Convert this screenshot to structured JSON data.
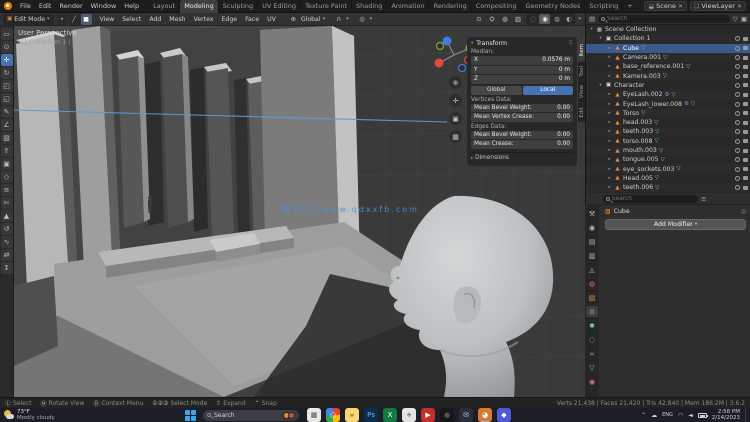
{
  "colors": {
    "accent": "#4772b3",
    "selection": "#3a5a8c",
    "header_bg": "#1d1d1d",
    "viewport_bg": "#464646",
    "mesh_icon": "#e58a3a",
    "data_icon": "#6fcf8f",
    "watermark_blue": "#4b8fe0",
    "blender_orange": "#e87d0d"
  },
  "topbar": {
    "menus": [
      {
        "label": "File"
      },
      {
        "label": "Edit"
      },
      {
        "label": "Render"
      },
      {
        "label": "Window"
      },
      {
        "label": "Help"
      }
    ],
    "workspaces": [
      {
        "label": "Layout"
      },
      {
        "label": "Modeling",
        "active": true
      },
      {
        "label": "Sculpting"
      },
      {
        "label": "UV Editing"
      },
      {
        "label": "Texture Paint"
      },
      {
        "label": "Shading"
      },
      {
        "label": "Animation"
      },
      {
        "label": "Rendering"
      },
      {
        "label": "Compositing"
      },
      {
        "label": "Geometry Nodes"
      },
      {
        "label": "Scripting"
      }
    ],
    "add_workspace": "+",
    "scene": {
      "icon": "⬓",
      "label": "Scene",
      "close": "✕"
    },
    "view_layer": {
      "icon": "❏",
      "label": "ViewLayer",
      "close": "✕"
    }
  },
  "viewport_header": {
    "mode_icon": "▣",
    "mode": "Edit Mode",
    "caret": "▾",
    "select_modes": [
      {
        "glyph": "•"
      },
      {
        "glyph": "╱"
      },
      {
        "glyph": "■",
        "active": true
      }
    ],
    "menus": [
      {
        "label": "View"
      },
      {
        "label": "Select"
      },
      {
        "label": "Add"
      },
      {
        "label": "Mesh"
      },
      {
        "label": "Vertex"
      },
      {
        "label": "Edge"
      },
      {
        "label": "Face"
      },
      {
        "label": "UV"
      }
    ],
    "orientation_icon": "⊕",
    "orientation": "Global",
    "snap_icon": "∩",
    "proportional_icon": "◎",
    "right_icons": [
      {
        "glyph": "⊙"
      },
      {
        "glyph": "⛭",
        "active": true
      },
      {
        "glyph": "◍"
      },
      {
        "glyph": "▥"
      }
    ],
    "shading_modes": [
      {
        "glyph": "◌"
      },
      {
        "glyph": "◉",
        "active": true
      },
      {
        "glyph": "◍"
      },
      {
        "glyph": "◐"
      }
    ]
  },
  "tools": [
    {
      "glyph": "▭"
    },
    {
      "glyph": "⊙"
    },
    {
      "glyph": "✛",
      "active": true
    },
    {
      "glyph": "↻"
    },
    {
      "glyph": "◰"
    },
    {
      "glyph": "◱"
    },
    {
      "glyph": "✎"
    },
    {
      "glyph": "∠"
    },
    {
      "glyph": "▧"
    },
    {
      "glyph": "⇑"
    },
    {
      "glyph": "▣"
    },
    {
      "glyph": "◇"
    },
    {
      "glyph": "≡"
    },
    {
      "glyph": "✄"
    },
    {
      "glyph": "▲"
    },
    {
      "glyph": "↺"
    },
    {
      "glyph": "∿"
    },
    {
      "glyph": "⇄"
    },
    {
      "glyph": "↕"
    }
  ],
  "viewport": {
    "overlay_line1": "User Perspective",
    "overlay_line2": "(1) Collection 1 | Cube",
    "watermark": "格艺CG  www.qdxxfb.com",
    "gizmo_buttons": [
      {
        "glyph": "⊕"
      },
      {
        "glyph": "✛"
      },
      {
        "glyph": "▣"
      },
      {
        "glyph": "▦"
      }
    ]
  },
  "npanel": {
    "title": "Transform",
    "dots": "⠿",
    "median_label": "Median:",
    "axes": [
      {
        "label": "X",
        "value": "0.0576 m"
      },
      {
        "label": "Y",
        "value": "0 m"
      },
      {
        "label": "Z",
        "value": "0 m"
      }
    ],
    "space_toggle": [
      {
        "label": "Global"
      },
      {
        "label": "Local",
        "active": true
      }
    ],
    "vertex_section": "Vertices Data:",
    "vertex_rows": [
      {
        "label": "Mean Bevel Weight:",
        "value": "0.00"
      },
      {
        "label": "Mean Vertex Crease:",
        "value": "0.00"
      }
    ],
    "edge_section": "Edges Data:",
    "edge_rows": [
      {
        "label": "Mean Bevel Weight:",
        "value": "0.00"
      },
      {
        "label": "Mean Crease:",
        "value": "0.00"
      }
    ],
    "dimensions_label": "Dimensions",
    "dimensions_arrow": "▸",
    "tabs": [
      {
        "label": "Item",
        "active": true
      },
      {
        "label": "Tool"
      },
      {
        "label": "View"
      },
      {
        "label": "Edit"
      }
    ]
  },
  "outliner": {
    "search_placeholder": "Search",
    "filter_icon": "▽",
    "display_icon": "▤",
    "new_collection_icon": "▣",
    "rows": [
      {
        "icon": "▦",
        "arrow": "▾",
        "name": "Scene Collection",
        "indent": 0,
        "cls": "ic-scene no-toggles"
      },
      {
        "icon": "▣",
        "arrow": "▾",
        "name": "Collection 1",
        "indent": 1,
        "cls": "ic-col"
      },
      {
        "icon": "▲",
        "arrow": "▸",
        "name": "Cube",
        "indent": 2,
        "cls": "ic-mesh has-data",
        "selected": true
      },
      {
        "icon": "▲",
        "arrow": "▸",
        "name": "Camera.001",
        "indent": 2,
        "cls": "ic-mesh has-data"
      },
      {
        "icon": "▲",
        "arrow": "▸",
        "name": "base_reference.001",
        "indent": 2,
        "cls": "ic-mesh has-data"
      },
      {
        "icon": "▲",
        "arrow": "▸",
        "name": "Kamera.003",
        "indent": 2,
        "cls": "ic-mesh has-data"
      },
      {
        "icon": "▣",
        "arrow": "▾",
        "name": "Character",
        "indent": 1,
        "cls": "ic-col"
      },
      {
        "icon": "▲",
        "arrow": "▸",
        "name": "EyeLash.002",
        "indent": 2,
        "cls": "ic-mesh has-wrench has-data"
      },
      {
        "icon": "▲",
        "arrow": "▸",
        "name": "EyeLash_lower.008",
        "indent": 2,
        "cls": "ic-mesh has-wrench has-data"
      },
      {
        "icon": "▲",
        "arrow": "▸",
        "name": "Torso",
        "indent": 2,
        "cls": "ic-mesh has-data"
      },
      {
        "icon": "▲",
        "arrow": "▸",
        "name": "head.003",
        "indent": 2,
        "cls": "ic-mesh has-data"
      },
      {
        "icon": "▲",
        "arrow": "▸",
        "name": "teeth.003",
        "indent": 2,
        "cls": "ic-mesh has-data"
      },
      {
        "icon": "▲",
        "arrow": "▸",
        "name": "torso.008",
        "indent": 2,
        "cls": "ic-mesh has-data"
      },
      {
        "icon": "▲",
        "arrow": "▸",
        "name": "mouth.003",
        "indent": 2,
        "cls": "ic-mesh has-data"
      },
      {
        "icon": "▲",
        "arrow": "▸",
        "name": "tongue.005",
        "indent": 2,
        "cls": "ic-mesh has-data"
      },
      {
        "icon": "▲",
        "arrow": "▸",
        "name": "eye_sockets.003",
        "indent": 2,
        "cls": "ic-mesh has-data"
      },
      {
        "icon": "▲",
        "arrow": "▸",
        "name": "Head.005",
        "indent": 2,
        "cls": "ic-mesh has-data"
      },
      {
        "icon": "▲",
        "arrow": "▸",
        "name": "teeth.006",
        "indent": 2,
        "cls": "ic-mesh has-data"
      }
    ]
  },
  "properties": {
    "search_placeholder": "Search",
    "breadcrumb_icon": "▧",
    "breadcrumb": "Cube",
    "pin_icon": "◎",
    "add_modifier_label": "Add Modifier",
    "add_modifier_caret": "▾",
    "tabs": [
      {
        "glyph": "⚒",
        "fg": "#b9b9b9"
      },
      {
        "glyph": "◉",
        "fg": "#b9b9b9"
      },
      {
        "glyph": "▤",
        "fg": "#b9b9b9"
      },
      {
        "glyph": "▥",
        "fg": "#b9b9b9"
      },
      {
        "glyph": "◬",
        "fg": "#b9b9b9"
      },
      {
        "glyph": "◍",
        "fg": "#d37676"
      },
      {
        "glyph": "▧",
        "fg": "#e58a3a"
      },
      {
        "glyph": "⚙",
        "fg": "#6f9fd8",
        "active": true
      },
      {
        "glyph": "✱",
        "fg": "#6fd8c9"
      },
      {
        "glyph": "◌",
        "fg": "#6fd8c9"
      },
      {
        "glyph": "∞",
        "fg": "#9a9a9a"
      },
      {
        "glyph": "▽",
        "fg": "#7fd49a"
      },
      {
        "glyph": "◉",
        "fg": "#d97b6c"
      }
    ]
  },
  "statusbar": {
    "hints": [
      {
        "keys": "Ⓛ",
        "label": "Select"
      },
      {
        "keys": "Ⓜ",
        "label": "Rotate View"
      },
      {
        "keys": "Ⓡ",
        "label": "Context Menu"
      },
      {
        "keys": "①②③",
        "label": "Select Mode"
      },
      {
        "keys": "⇧",
        "label": "Expand"
      },
      {
        "keys": "⌃",
        "label": "Snap"
      }
    ],
    "stats": "Verts 21,438  |  Faces 21,420  |  Tris 42,840  |  Mem 186.2M  |  3.6.2"
  },
  "taskbar": {
    "weather_temp": "73°F",
    "weather_desc": "Mostly cloudy",
    "search_label": "Search",
    "apps": [
      {
        "glyph": "▦",
        "bg": "#e9e9e9",
        "fg": "#4a4a4a"
      },
      {
        "glyph": "○",
        "bg": "conic-gradient(#ea4335 0 25%, #fbbc05 25% 50%, #34a853 50% 75%, #4285f4 75% 100%)",
        "fg": "#ffffff"
      },
      {
        "glyph": "▰",
        "bg": "#f8d775",
        "fg": "#b8932f"
      },
      {
        "glyph": "Ps",
        "bg": "#0d2b4d",
        "fg": "#6fb4ff"
      },
      {
        "glyph": "X",
        "bg": "#107c41",
        "fg": "#ffffff"
      },
      {
        "glyph": "+",
        "bg": "#e4e4e4",
        "fg": "#333333"
      },
      {
        "glyph": "▶",
        "bg": "#c4302b",
        "fg": "#ffffff"
      },
      {
        "glyph": "●",
        "bg": "#17171b",
        "fg": "#555555"
      },
      {
        "glyph": "✉",
        "bg": "#2b2e36",
        "fg": "#9ecbff"
      },
      {
        "glyph": "◕",
        "bg": "#d97b2f",
        "fg": "#ffffff",
        "active": true
      },
      {
        "glyph": "◆",
        "bg": "#4e5bd4",
        "fg": "#ffffff"
      }
    ],
    "tray_chevron": "⌃",
    "tray_cloud": "☁",
    "tray_lang": "ENG",
    "tray_wifi": "◠",
    "tray_vol": "◄",
    "time": "2:58 PM",
    "date": "2/14/2023"
  }
}
